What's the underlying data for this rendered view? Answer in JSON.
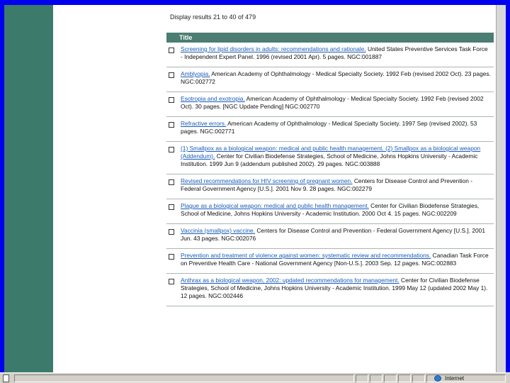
{
  "results_summary": "Display results 21 to 40 of 479",
  "table_header": "Title",
  "results": [
    {
      "title": "Screening for lipid disorders in adults: recommendations and rationale.",
      "citation": " United States Preventive Services Task Force - Independent Expert Panel. 1996 (revised 2001 Apr). 5 pages. NGC:001887"
    },
    {
      "title": "Amblyopia.",
      "citation": " American Academy of Ophthalmology - Medical Specialty Society. 1992 Feb (revised 2002 Oct). 23 pages. NGC:002772"
    },
    {
      "title": "Esotropia and exotropia.",
      "citation": " American Academy of Ophthalmology - Medical Specialty Society. 1992 Feb (revised 2002 Oct). 30 pages. [NGC Update Pending] NGC:002770"
    },
    {
      "title": "Refractive errors.",
      "citation": " American Academy of Ophthalmology - Medical Specialty Society. 1997 Sep (revised 2002). 53 pages. NGC:002771"
    },
    {
      "title": "(1) Smallpox as a biological weapon: medical and public health management. (2) Smallpox as a biological weapon (Addendum).",
      "citation": " Center for Civilian Biodefense Strategies, School of Medicine, Johns Hopkins University - Academic Institution. 1999 Jun 9 (addendum published 2002). 29 pages. NGC:003888"
    },
    {
      "title": "Revised recommendations for HIV screening of pregnant women.",
      "citation": " Centers for Disease Control and Prevention - Federal Government Agency [U.S.]. 2001 Nov 9. 28 pages. NGC:002279"
    },
    {
      "title": "Plague as a biological weapon: medical and public health management.",
      "citation": " Center for Civilian Biodefense Strategies, School of Medicine, Johns Hopkins University - Academic Institution. 2000 Oct 4. 15 pages. NGC:002209"
    },
    {
      "title": "Vaccinia (smallpox) vaccine.",
      "citation": " Centers for Disease Control and Prevention - Federal Government Agency [U.S.]. 2001 Jun. 43 pages. NGC:002076"
    },
    {
      "title": "Prevention and treatment of violence against women: systematic review and recommendations.",
      "citation": " Canadian Task Force on Preventive Health Care - National Government Agency [Non-U.S.]. 2003 Sep. 12 pages. NGC:002883"
    },
    {
      "title": "Anthrax as a biological weapon, 2002: updated recommendations for management.",
      "citation": " Center for Civilian Biodefense Strategies, School of Medicine, Johns Hopkins University - Academic Institution. 1999 May 12 (updated 2002 May 1). 12 pages. NGC:002446"
    }
  ],
  "status": {
    "zone": "Internet"
  },
  "colors": {
    "sidebar": "#3c7a6c",
    "header": "#4b7d72",
    "link": "#1a5bb8",
    "frame": "#0000ee"
  }
}
